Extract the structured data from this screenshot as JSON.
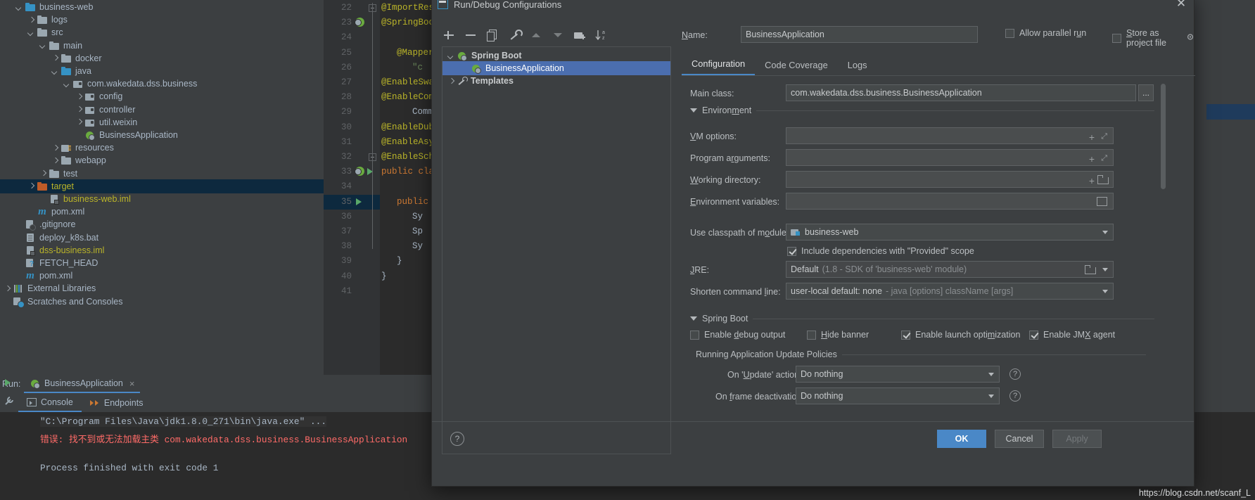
{
  "project_tree": {
    "rows": [
      {
        "label": "business-web",
        "indent": 0,
        "icon": "module-icon",
        "arrow": "down",
        "style": "normal",
        "clipped": true
      },
      {
        "label": "logs",
        "indent": 1,
        "icon": "folder-icon",
        "arrow": "right",
        "style": "normal"
      },
      {
        "label": "src",
        "indent": 1,
        "icon": "folder-icon",
        "arrow": "down",
        "style": "normal"
      },
      {
        "label": "main",
        "indent": 2,
        "icon": "folder-icon",
        "arrow": "down",
        "style": "normal"
      },
      {
        "label": "docker",
        "indent": 3,
        "icon": "folder-icon",
        "arrow": "right",
        "style": "normal"
      },
      {
        "label": "java",
        "indent": 3,
        "icon": "source-folder-icon",
        "arrow": "down",
        "style": "normal"
      },
      {
        "label": "com.wakedata.dss.business",
        "indent": 4,
        "icon": "package-icon",
        "arrow": "down",
        "style": "normal"
      },
      {
        "label": "config",
        "indent": 5,
        "icon": "package-icon",
        "arrow": "right",
        "style": "normal"
      },
      {
        "label": "controller",
        "indent": 5,
        "icon": "package-icon",
        "arrow": "right",
        "style": "normal"
      },
      {
        "label": "util.weixin",
        "indent": 5,
        "icon": "package-icon",
        "arrow": "right",
        "style": "normal"
      },
      {
        "label": "BusinessApplication",
        "indent": 5,
        "icon": "spring-boot-class-icon",
        "arrow": "none",
        "style": "normal"
      },
      {
        "label": "resources",
        "indent": 3,
        "icon": "resources-folder-icon",
        "arrow": "right",
        "style": "normal"
      },
      {
        "label": "webapp",
        "indent": 3,
        "icon": "folder-icon",
        "arrow": "right",
        "style": "normal"
      },
      {
        "label": "test",
        "indent": 2,
        "icon": "folder-icon",
        "arrow": "right",
        "style": "normal"
      },
      {
        "label": "target",
        "indent": 1,
        "icon": "excluded-folder-icon",
        "arrow": "right",
        "style": "excluded",
        "selected": true
      },
      {
        "label": "business-web.iml",
        "indent": 2,
        "icon": "iml-file-icon",
        "arrow": "none",
        "style": "excluded"
      },
      {
        "label": "pom.xml",
        "indent": 1,
        "icon": "maven-icon",
        "arrow": "none",
        "style": "normal"
      },
      {
        "label": ".gitignore",
        "indent": 0,
        "icon": "gitignore-icon",
        "arrow": "none",
        "style": "normal"
      },
      {
        "label": "deploy_k8s.bat",
        "indent": 0,
        "icon": "file-icon",
        "arrow": "none",
        "style": "normal"
      },
      {
        "label": "dss-business.iml",
        "indent": 0,
        "icon": "iml-file-icon",
        "arrow": "none",
        "style": "excluded"
      },
      {
        "label": "FETCH_HEAD",
        "indent": 0,
        "icon": "fetch-head-icon",
        "arrow": "none",
        "style": "normal"
      },
      {
        "label": "pom.xml",
        "indent": 0,
        "icon": "maven-icon",
        "arrow": "none",
        "style": "normal"
      },
      {
        "label": "External Libraries",
        "indent": -1,
        "icon": "libraries-icon",
        "arrow": "right",
        "style": "normal"
      },
      {
        "label": "Scratches and Consoles",
        "indent": -1,
        "icon": "scratches-icon",
        "arrow": "none",
        "style": "normal"
      }
    ]
  },
  "editor": {
    "lines": [
      {
        "num": "22",
        "text": "@ImportRes",
        "kind": "ann",
        "fold": "end"
      },
      {
        "num": "23",
        "text": "@SpringBoo",
        "kind": "ann",
        "gutter": "bean"
      },
      {
        "num": "24",
        "text": "",
        "kind": "plain"
      },
      {
        "num": "25",
        "text": "@MapperSca",
        "kind": "ann",
        "indent": 1
      },
      {
        "num": "26",
        "text": "\"c",
        "kind": "str",
        "indent": 2
      },
      {
        "num": "27",
        "text": "@EnableSwa",
        "kind": "ann"
      },
      {
        "num": "28",
        "text": "@EnableCom",
        "kind": "ann"
      },
      {
        "num": "29",
        "text": "Common",
        "kind": "plain",
        "indent": 2
      },
      {
        "num": "30",
        "text": "@EnableDub",
        "kind": "ann"
      },
      {
        "num": "31",
        "text": "@EnableAsy",
        "kind": "ann"
      },
      {
        "num": "32",
        "text": "@EnableSch",
        "kind": "ann",
        "fold": "start"
      },
      {
        "num": "33",
        "text": "public cla",
        "kind": "kw",
        "gutter": "bean-run"
      },
      {
        "num": "34",
        "text": "",
        "kind": "plain"
      },
      {
        "num": "35",
        "text": "public",
        "kind": "kw",
        "gutter": "run",
        "indent": 1,
        "selected": true
      },
      {
        "num": "36",
        "text": "Sy",
        "kind": "plain",
        "indent": 2
      },
      {
        "num": "37",
        "text": "Sp",
        "kind": "plain",
        "indent": 2
      },
      {
        "num": "38",
        "text": "Sy",
        "kind": "plain",
        "indent": 2
      },
      {
        "num": "39",
        "text": "}",
        "kind": "plain",
        "indent": 1
      },
      {
        "num": "40",
        "text": "}",
        "kind": "plain"
      },
      {
        "num": "41",
        "text": "",
        "kind": "plain"
      }
    ]
  },
  "run_panel": {
    "run_label": "Run:",
    "tab_title": "BusinessApplication",
    "tab_close": "×",
    "subtabs": [
      {
        "label": "Console",
        "active": true,
        "icon": "console-icon"
      },
      {
        "label": "Endpoints",
        "active": false,
        "icon": "endpoints-icon"
      }
    ],
    "console_lines": [
      {
        "text": "\"C:\\Program Files\\Java\\jdk1.8.0_271\\bin\\java.exe\" ...",
        "type": "command"
      },
      {
        "text": "错误: 找不到或无法加载主类 com.wakedata.dss.business.BusinessApplication",
        "type": "error"
      },
      {
        "text": "Process finished with exit code 1",
        "type": "info"
      }
    ]
  },
  "dialog": {
    "title": "Run/Debug Configurations",
    "close_label": "✕",
    "toolbar": [
      {
        "name": "add-configuration-button",
        "icon": "plus-icon"
      },
      {
        "name": "remove-configuration-button",
        "icon": "minus-icon"
      },
      {
        "name": "copy-configuration-button",
        "icon": "copy-icon"
      },
      {
        "name": "edit-templates-button",
        "icon": "wrench-icon"
      },
      {
        "name": "move-up-button",
        "icon": "arrow-up-icon"
      },
      {
        "name": "move-down-button",
        "icon": "arrow-down-icon"
      },
      {
        "name": "new-folder-button",
        "icon": "new-folder-icon"
      },
      {
        "name": "sort-configurations-button",
        "icon": "sort-az-icon"
      }
    ],
    "tree": [
      {
        "label": "Spring Boot",
        "indent": 0,
        "arrow": "down",
        "icon": "spring-boot-icon",
        "bold": true,
        "selected": false
      },
      {
        "label": "BusinessApplication",
        "indent": 1,
        "arrow": "none",
        "icon": "spring-boot-icon",
        "bold": false,
        "selected": true
      },
      {
        "label": "Templates",
        "indent": 0,
        "arrow": "right",
        "icon": "wrench-icon",
        "bold": true,
        "selected": false
      }
    ],
    "name_label": "Name:",
    "name_value": "BusinessApplication",
    "allow_parallel_run": {
      "label": "Allow parallel run",
      "checked": false
    },
    "store_as_project_file": {
      "label": "Store as project file",
      "checked": false,
      "icon": "gear-icon"
    },
    "tabs": [
      {
        "label": "Configuration",
        "active": true
      },
      {
        "label": "Code Coverage",
        "active": false
      },
      {
        "label": "Logs",
        "active": false
      }
    ],
    "main_class": {
      "label": "Main class:",
      "value": "com.wakedata.dss.business.BusinessApplication",
      "browse": "..."
    },
    "environment_section": "Environment",
    "vm_options": {
      "label": "VM options:",
      "value": ""
    },
    "program_arguments": {
      "label": "Program arguments:",
      "value": ""
    },
    "working_directory": {
      "label": "Working directory:",
      "value": ""
    },
    "environment_variables": {
      "label": "Environment variables:",
      "value": ""
    },
    "use_classpath": {
      "label": "Use classpath of module:",
      "value": "business-web",
      "icon": "module-icon"
    },
    "include_provided": {
      "label": "Include dependencies with \"Provided\" scope",
      "checked": true
    },
    "jre": {
      "label": "JRE:",
      "value": "Default",
      "hint": "(1.8 - SDK of 'business-web' module)"
    },
    "shorten_command_line": {
      "label": "Shorten command line:",
      "value": "user-local default: none",
      "hint": "- java [options] className [args]"
    },
    "spring_boot_section": "Spring Boot",
    "spring_checkboxes": [
      {
        "label": "Enable debug output",
        "checked": false
      },
      {
        "label": "Hide banner",
        "checked": false
      },
      {
        "label": "Enable launch optimization",
        "checked": true
      },
      {
        "label": "Enable JMX agent",
        "checked": true
      }
    ],
    "update_policies_section": "Running Application Update Policies",
    "on_update_action": {
      "label": "On 'Update' action:",
      "value": "Do nothing"
    },
    "on_frame_deactivation": {
      "label": "On frame deactivation:",
      "value": "Do nothing"
    },
    "help_button": "?",
    "buttons": {
      "ok": "OK",
      "cancel": "Cancel",
      "apply": "Apply"
    }
  },
  "watermark": "https://blog.csdn.net/scanf_L",
  "colors": {
    "accent_blue": "#4a88c7",
    "selection_blue": "#4b6eaf",
    "tree_selection": "#0d293e",
    "error_red": "#ff6b68",
    "annotation_yellow": "#bbb529",
    "keyword_orange": "#cc7832",
    "string_green": "#6a8759",
    "excluded_yellow": "#bbb529",
    "panel_bg": "#3c3f41",
    "editor_bg": "#2b2b2b"
  }
}
